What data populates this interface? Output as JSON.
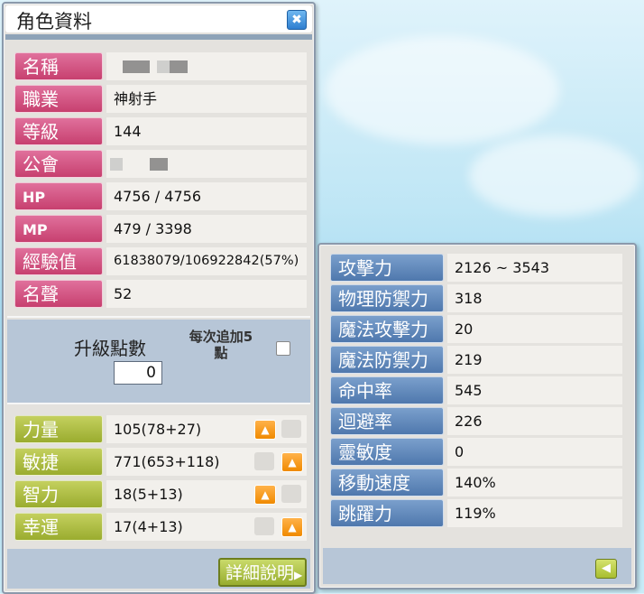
{
  "character_window": {
    "title": "角色資料",
    "close_icon": "close-icon",
    "info": [
      {
        "label": "名稱",
        "value": "",
        "redacted": true
      },
      {
        "label": "職業",
        "value": "神射手"
      },
      {
        "label": "等級",
        "value": "144"
      },
      {
        "label": "公會",
        "value": "",
        "redacted": true
      },
      {
        "label": "HP",
        "value": "4756 / 4756"
      },
      {
        "label": "MP",
        "value": "479 / 3398"
      },
      {
        "label": "經驗值",
        "value": "61838079/106922842(57%)"
      },
      {
        "label": "名聲",
        "value": "52"
      }
    ],
    "ability_points": {
      "label": "升級點數",
      "value": "0",
      "auto_label_line1": "每次追加5",
      "auto_label_line2": "點"
    },
    "stats": [
      {
        "label": "力量",
        "value": "105(78+27)"
      },
      {
        "label": "敏捷",
        "value": "771(653+118)"
      },
      {
        "label": "智力",
        "value": "18(5+13)"
      },
      {
        "label": "幸運",
        "value": "17(4+13)"
      }
    ],
    "detail_button": "詳細說明",
    "detail_button_icon": "chevron-right-icon"
  },
  "detail_window": {
    "stats": [
      {
        "label": "攻擊力",
        "value": "2126 ~ 3543"
      },
      {
        "label": "物理防禦力",
        "value": "318"
      },
      {
        "label": "魔法攻擊力",
        "value": "20"
      },
      {
        "label": "魔法防禦力",
        "value": "219"
      },
      {
        "label": "命中率",
        "value": "545"
      },
      {
        "label": "迴避率",
        "value": "226"
      },
      {
        "label": "靈敏度",
        "value": "0"
      },
      {
        "label": "移動速度",
        "value": "140%"
      },
      {
        "label": "跳躍力",
        "value": "119%"
      }
    ],
    "back_icon": "arrow-left-icon"
  },
  "colors": {
    "info_label": "#d4568a",
    "stat_label": "#b2c146",
    "detail_label": "#6289bd",
    "up_button": "#f59a10"
  }
}
